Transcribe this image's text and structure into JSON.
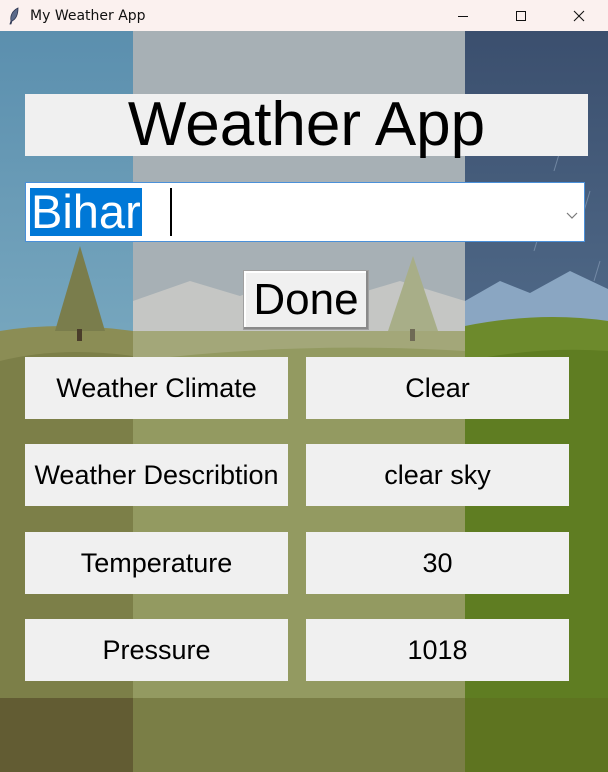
{
  "window": {
    "title": "My Weather App",
    "icon": "feather-icon",
    "controls": [
      "minimize-icon",
      "maximize-icon",
      "close-icon"
    ]
  },
  "app": {
    "heading": "Weather App",
    "location_select": {
      "value": "Bihar"
    },
    "done_label": "Done"
  },
  "results": [
    {
      "label": "Weather Climate",
      "value": "Clear"
    },
    {
      "label": "Weather Describtion",
      "value": "clear sky"
    },
    {
      "label": "Temperature",
      "value": "30"
    },
    {
      "label": "Pressure",
      "value": "1018"
    }
  ],
  "colors": {
    "titlebar": "#fbf1ef",
    "widget_bg": "#f0f0f0",
    "selection": "#0078d7",
    "combo_border": "#4a90d9"
  }
}
